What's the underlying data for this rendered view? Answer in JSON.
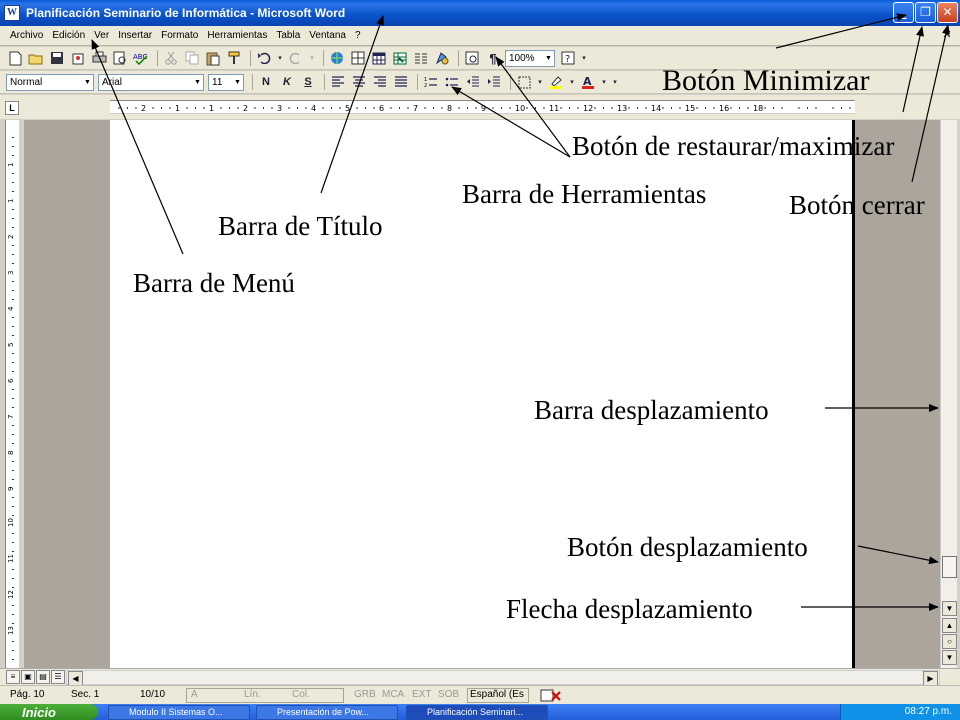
{
  "window": {
    "title": "Planificación Seminario de Informática - Microsoft Word",
    "app_icon": "W",
    "minimize_glyph": "_",
    "restore_glyph": "❐",
    "close_glyph": "✕"
  },
  "menu": {
    "items": [
      "Archivo",
      "Edición",
      "Ver",
      "Insertar",
      "Formato",
      "Herramientas",
      "Tabla",
      "Ventana",
      "?"
    ],
    "doc_close": "✕"
  },
  "toolbar_standard": {
    "zoom": "100%"
  },
  "toolbar_format": {
    "style": "Normal",
    "font": "Arial",
    "size": "11",
    "bold": "N",
    "italic": "K",
    "underline": "S"
  },
  "ruler": {
    "tab_selector": "L",
    "numbers": [
      "2",
      "1",
      "1",
      "2",
      "3",
      "4",
      "5",
      "6",
      "7",
      "8",
      "9",
      "10",
      "11",
      "12",
      "13",
      "14",
      "15",
      "16",
      "18"
    ],
    "vertical_numbers": [
      "1",
      "1",
      "2",
      "3",
      "4",
      "5",
      "6",
      "7",
      "8",
      "9",
      "10",
      "11",
      "12",
      "13"
    ]
  },
  "statusbar": {
    "page": "Pág. 10",
    "section": "Sec. 1",
    "pages": "10/10",
    "at": "A",
    "line": "Lín.",
    "col": "Col.",
    "grb": "GRB",
    "mca": "MCA",
    "ext": "EXT",
    "sob": "SOB",
    "language": "Español (Es"
  },
  "taskbar": {
    "start": "Inicio",
    "tasks": [
      "Modulo II Sistemas O...",
      "Presentación de Pow...",
      "Planificación Seminari..."
    ],
    "clock": "08:27 p.m."
  },
  "annotations": {
    "minimize": "Botón Minimizar",
    "restore": "Botón de restaurar/maximizar",
    "toolbar": "Barra de Herramientas",
    "close": "Botón cerrar",
    "titlebar": "Barra de Título",
    "menubar": "Barra de Menú",
    "scrollbar": "Barra desplazamiento",
    "scroll_button": "Botón desplazamiento",
    "scroll_arrow": "Flecha desplazamiento"
  },
  "icons": {
    "toolbar_standard": [
      "new-icon",
      "open-icon",
      "save-icon",
      "permission-icon",
      "print-icon",
      "print-preview-icon",
      "spelling-icon",
      "cut-icon",
      "copy-icon",
      "paste-icon",
      "format-painter-icon",
      "undo-icon",
      "redo-icon",
      "hyperlink-icon",
      "tables-borders-icon",
      "insert-table-icon",
      "insert-excel-icon",
      "columns-icon",
      "drawing-icon",
      "document-map-icon",
      "show-formatting-icon",
      "help-icon"
    ],
    "toolbar_format": [
      "align-left-icon",
      "center-icon",
      "align-right-icon",
      "justify-icon",
      "numbering-icon",
      "bullets-icon",
      "decrease-indent-icon",
      "increase-indent-icon",
      "border-icon",
      "highlight-icon",
      "font-color-icon"
    ]
  }
}
